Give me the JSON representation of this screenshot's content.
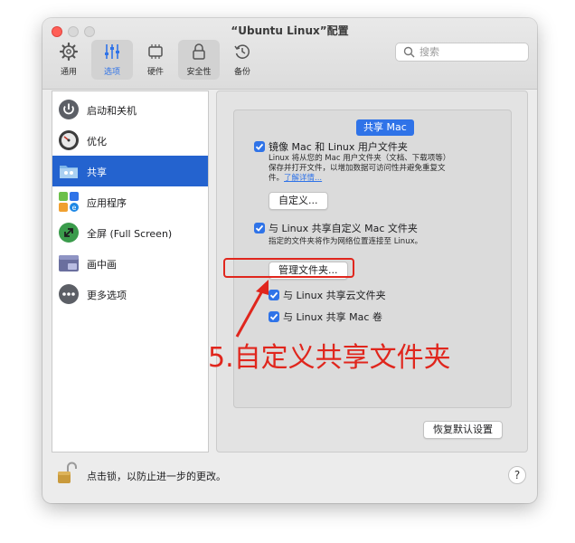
{
  "window": {
    "title": "“Ubuntu Linux”配置"
  },
  "toolbar": {
    "items": [
      {
        "label": "通用",
        "icon": "gear-icon"
      },
      {
        "label": "选项",
        "icon": "sliders-icon"
      },
      {
        "label": "硬件",
        "icon": "chip-icon"
      },
      {
        "label": "安全性",
        "icon": "lock-icon"
      },
      {
        "label": "备份",
        "icon": "clock-icon"
      }
    ],
    "active": "选项"
  },
  "search": {
    "placeholder": "搜索"
  },
  "sidebar": {
    "items": [
      {
        "label": "启动和关机",
        "icon": "power-icon"
      },
      {
        "label": "优化",
        "icon": "gauge-icon"
      },
      {
        "label": "共享",
        "icon": "shared-folder-icon"
      },
      {
        "label": "应用程序",
        "icon": "apps-icon"
      },
      {
        "label": "全屏 (Full Screen)",
        "icon": "fullscreen-icon"
      },
      {
        "label": "画中画",
        "icon": "picture-in-picture-icon"
      },
      {
        "label": "更多选项",
        "icon": "more-options-icon"
      }
    ],
    "selected": "共享"
  },
  "share_mac": {
    "group_title": "共享 Mac",
    "mirror_label": "镜像 Mac 和 Linux 用户文件夹",
    "mirror_desc_1": "Linux 将从您的 Mac 用户文件夹（文档、下载项等）",
    "mirror_desc_2": "保存并打开文件，以增加数据可访问性并避免重复文",
    "mirror_desc_3": "件。",
    "learn_more": "了解详情...",
    "customize_button": "自定义...",
    "custom_share_label": "与 Linux 共享自定义 Mac 文件夹",
    "custom_share_desc": "指定的文件夹将作为网络位置连接至 Linux。",
    "manage_button": "管理文件夹...",
    "cloud_label": "与 Linux 共享云文件夹",
    "volumes_label": "与 Linux 共享 Mac 卷",
    "restore_button": "恢复默认设置"
  },
  "annotation": {
    "text": "5.自定义共享文件夹",
    "color": "#e0261d"
  },
  "footer": {
    "lock_text": "点击锁，以防止进一步的更改。",
    "help_label": "?"
  },
  "colors": {
    "accent": "#2f73e8",
    "selection": "#2463cf",
    "annotation": "#e0261d"
  }
}
